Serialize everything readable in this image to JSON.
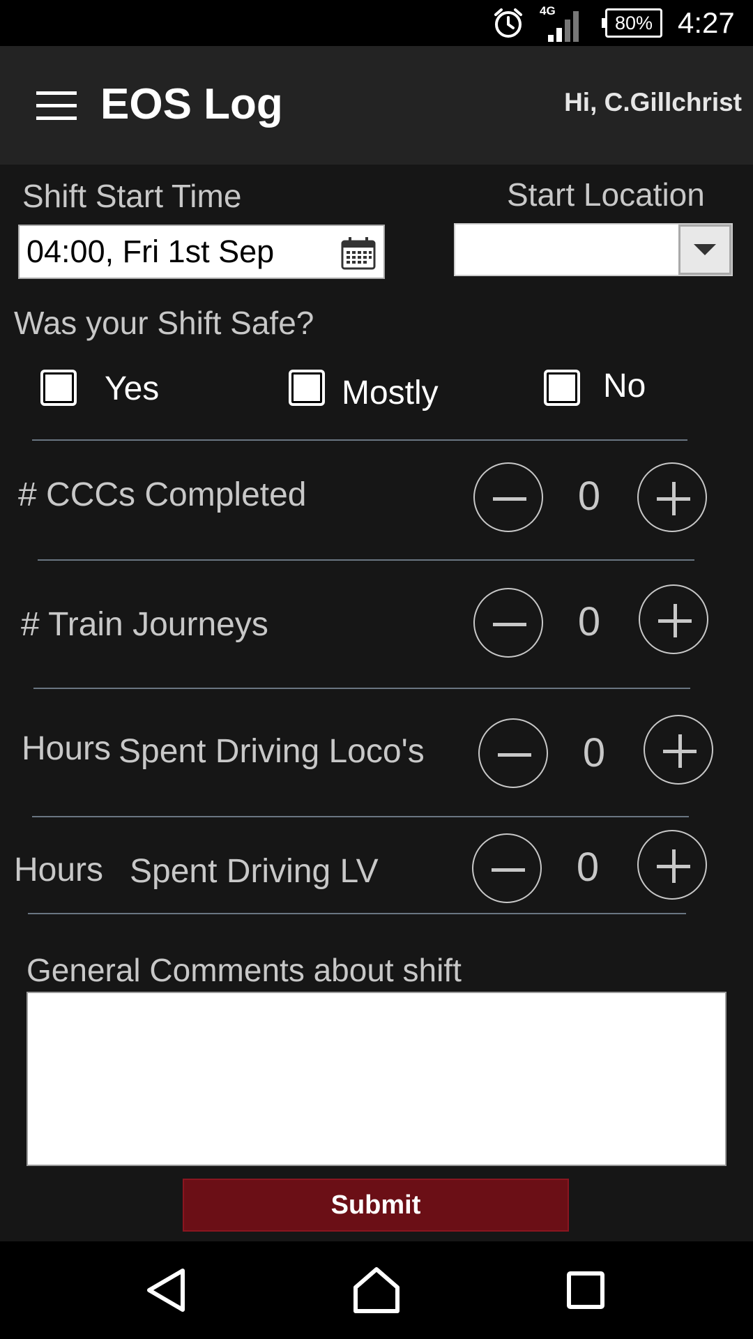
{
  "status_bar": {
    "network": "4G",
    "battery": "80%",
    "time": "4:27",
    "icons": [
      "alarm-icon",
      "signal-icon",
      "battery-icon"
    ]
  },
  "app_bar": {
    "title": "EOS Log",
    "greeting": "Hi, C.Gillchrist",
    "menu_icon": "hamburger-menu-icon"
  },
  "form": {
    "shift_start_label": "Shift Start Time",
    "shift_start_value": "04:00, Fri 1st Sep",
    "start_location_label": "Start Location",
    "start_location_value": "",
    "safe_question": "Was your Shift Safe?",
    "safe_options": [
      {
        "label": "Yes",
        "checked": false
      },
      {
        "label": "Mostly",
        "checked": false
      },
      {
        "label": "No",
        "checked": false
      }
    ],
    "counters": [
      {
        "label": "# CCCs Completed",
        "value": "0"
      },
      {
        "label": "# Train Journeys",
        "value": "0"
      },
      {
        "label_part1": "Hours",
        "label_part2": "Spent Driving Loco's",
        "value": "0"
      },
      {
        "label_part1": "Hours",
        "label_part2": "Spent Driving LV",
        "value": "0"
      }
    ],
    "comments_label": "General Comments about shift",
    "comments_value": "",
    "submit_label": "Submit"
  },
  "colors": {
    "background": "#161616",
    "app_bar": "#232323",
    "submit": "#6b0f16",
    "text": "#c8c8c8"
  }
}
